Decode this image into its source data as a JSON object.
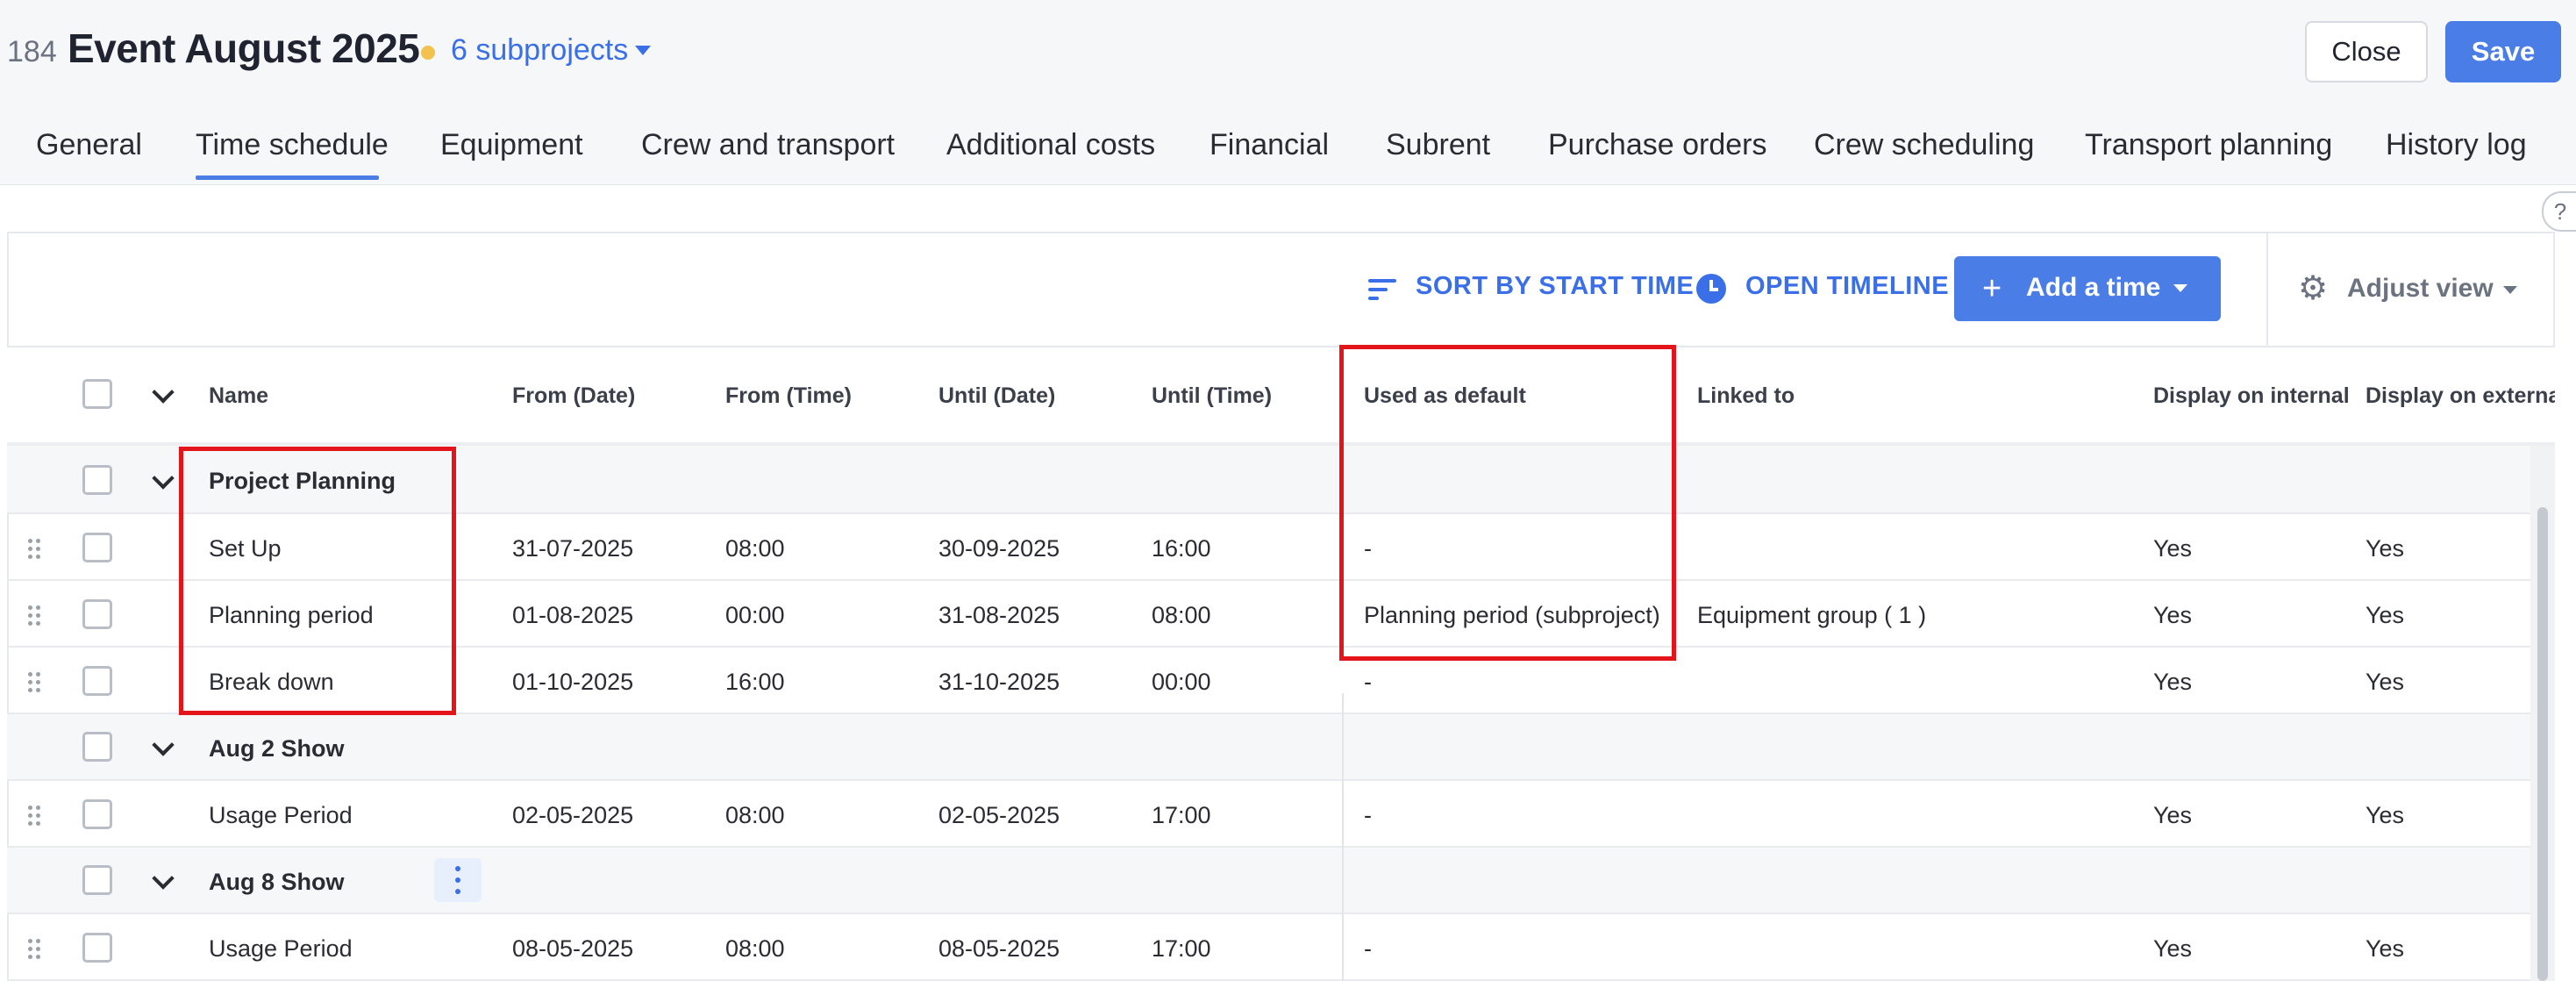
{
  "project": {
    "id": "184",
    "title": "Event August 2025",
    "subprojects_label": "6 subprojects",
    "status_color": "#f2c14e"
  },
  "actions": {
    "close_label": "Close",
    "save_label": "Save"
  },
  "tabs": [
    {
      "label": "General"
    },
    {
      "label": "Time schedule",
      "active": true
    },
    {
      "label": "Equipment"
    },
    {
      "label": "Crew and transport"
    },
    {
      "label": "Additional costs"
    },
    {
      "label": "Financial"
    },
    {
      "label": "Subrent"
    },
    {
      "label": "Purchase orders"
    },
    {
      "label": "Crew scheduling"
    },
    {
      "label": "Transport planning"
    },
    {
      "label": "History log"
    }
  ],
  "toolbar": {
    "sort_label": "SORT BY START TIME",
    "timeline_label": "OPEN TIMELINE",
    "add_label": "Add a time",
    "adjust_label": "Adjust view"
  },
  "columns": {
    "name": "Name",
    "from_date": "From (Date)",
    "from_time": "From (Time)",
    "until_date": "Until (Date)",
    "until_time": "Until (Time)",
    "used_default": "Used as default",
    "linked_to": "Linked to",
    "display_internal": "Display on internal c",
    "display_external": "Display on external c"
  },
  "groups": [
    {
      "name": "Project Planning",
      "rows": [
        {
          "name": "Set Up",
          "from_date": "31-07-2025",
          "from_time": "08:00",
          "until_date": "30-09-2025",
          "until_time": "16:00",
          "used_default": "-",
          "linked_to": "",
          "internal": "Yes",
          "external": "Yes"
        },
        {
          "name": "Planning period",
          "from_date": "01-08-2025",
          "from_time": "00:00",
          "until_date": "31-08-2025",
          "until_time": "08:00",
          "used_default": "Planning period (subproject)",
          "linked_to": "Equipment group ( 1 )",
          "internal": "Yes",
          "external": "Yes"
        },
        {
          "name": "Break down",
          "from_date": "01-10-2025",
          "from_time": "16:00",
          "until_date": "31-10-2025",
          "until_time": "00:00",
          "used_default": "-",
          "linked_to": "",
          "internal": "Yes",
          "external": "Yes"
        }
      ]
    },
    {
      "name": "Aug 2 Show",
      "rows": [
        {
          "name": "Usage Period",
          "from_date": "02-05-2025",
          "from_time": "08:00",
          "until_date": "02-05-2025",
          "until_time": "17:00",
          "used_default": "-",
          "linked_to": "",
          "internal": "Yes",
          "external": "Yes"
        }
      ]
    },
    {
      "name": "Aug 8 Show",
      "rows": [
        {
          "name": "Usage Period",
          "from_date": "08-05-2025",
          "from_time": "08:00",
          "until_date": "08-05-2025",
          "until_time": "17:00",
          "used_default": "-",
          "linked_to": "",
          "internal": "Yes",
          "external": "Yes"
        }
      ]
    }
  ],
  "colors": {
    "accent": "#4a7ee6",
    "highlight": "#e3151a"
  }
}
